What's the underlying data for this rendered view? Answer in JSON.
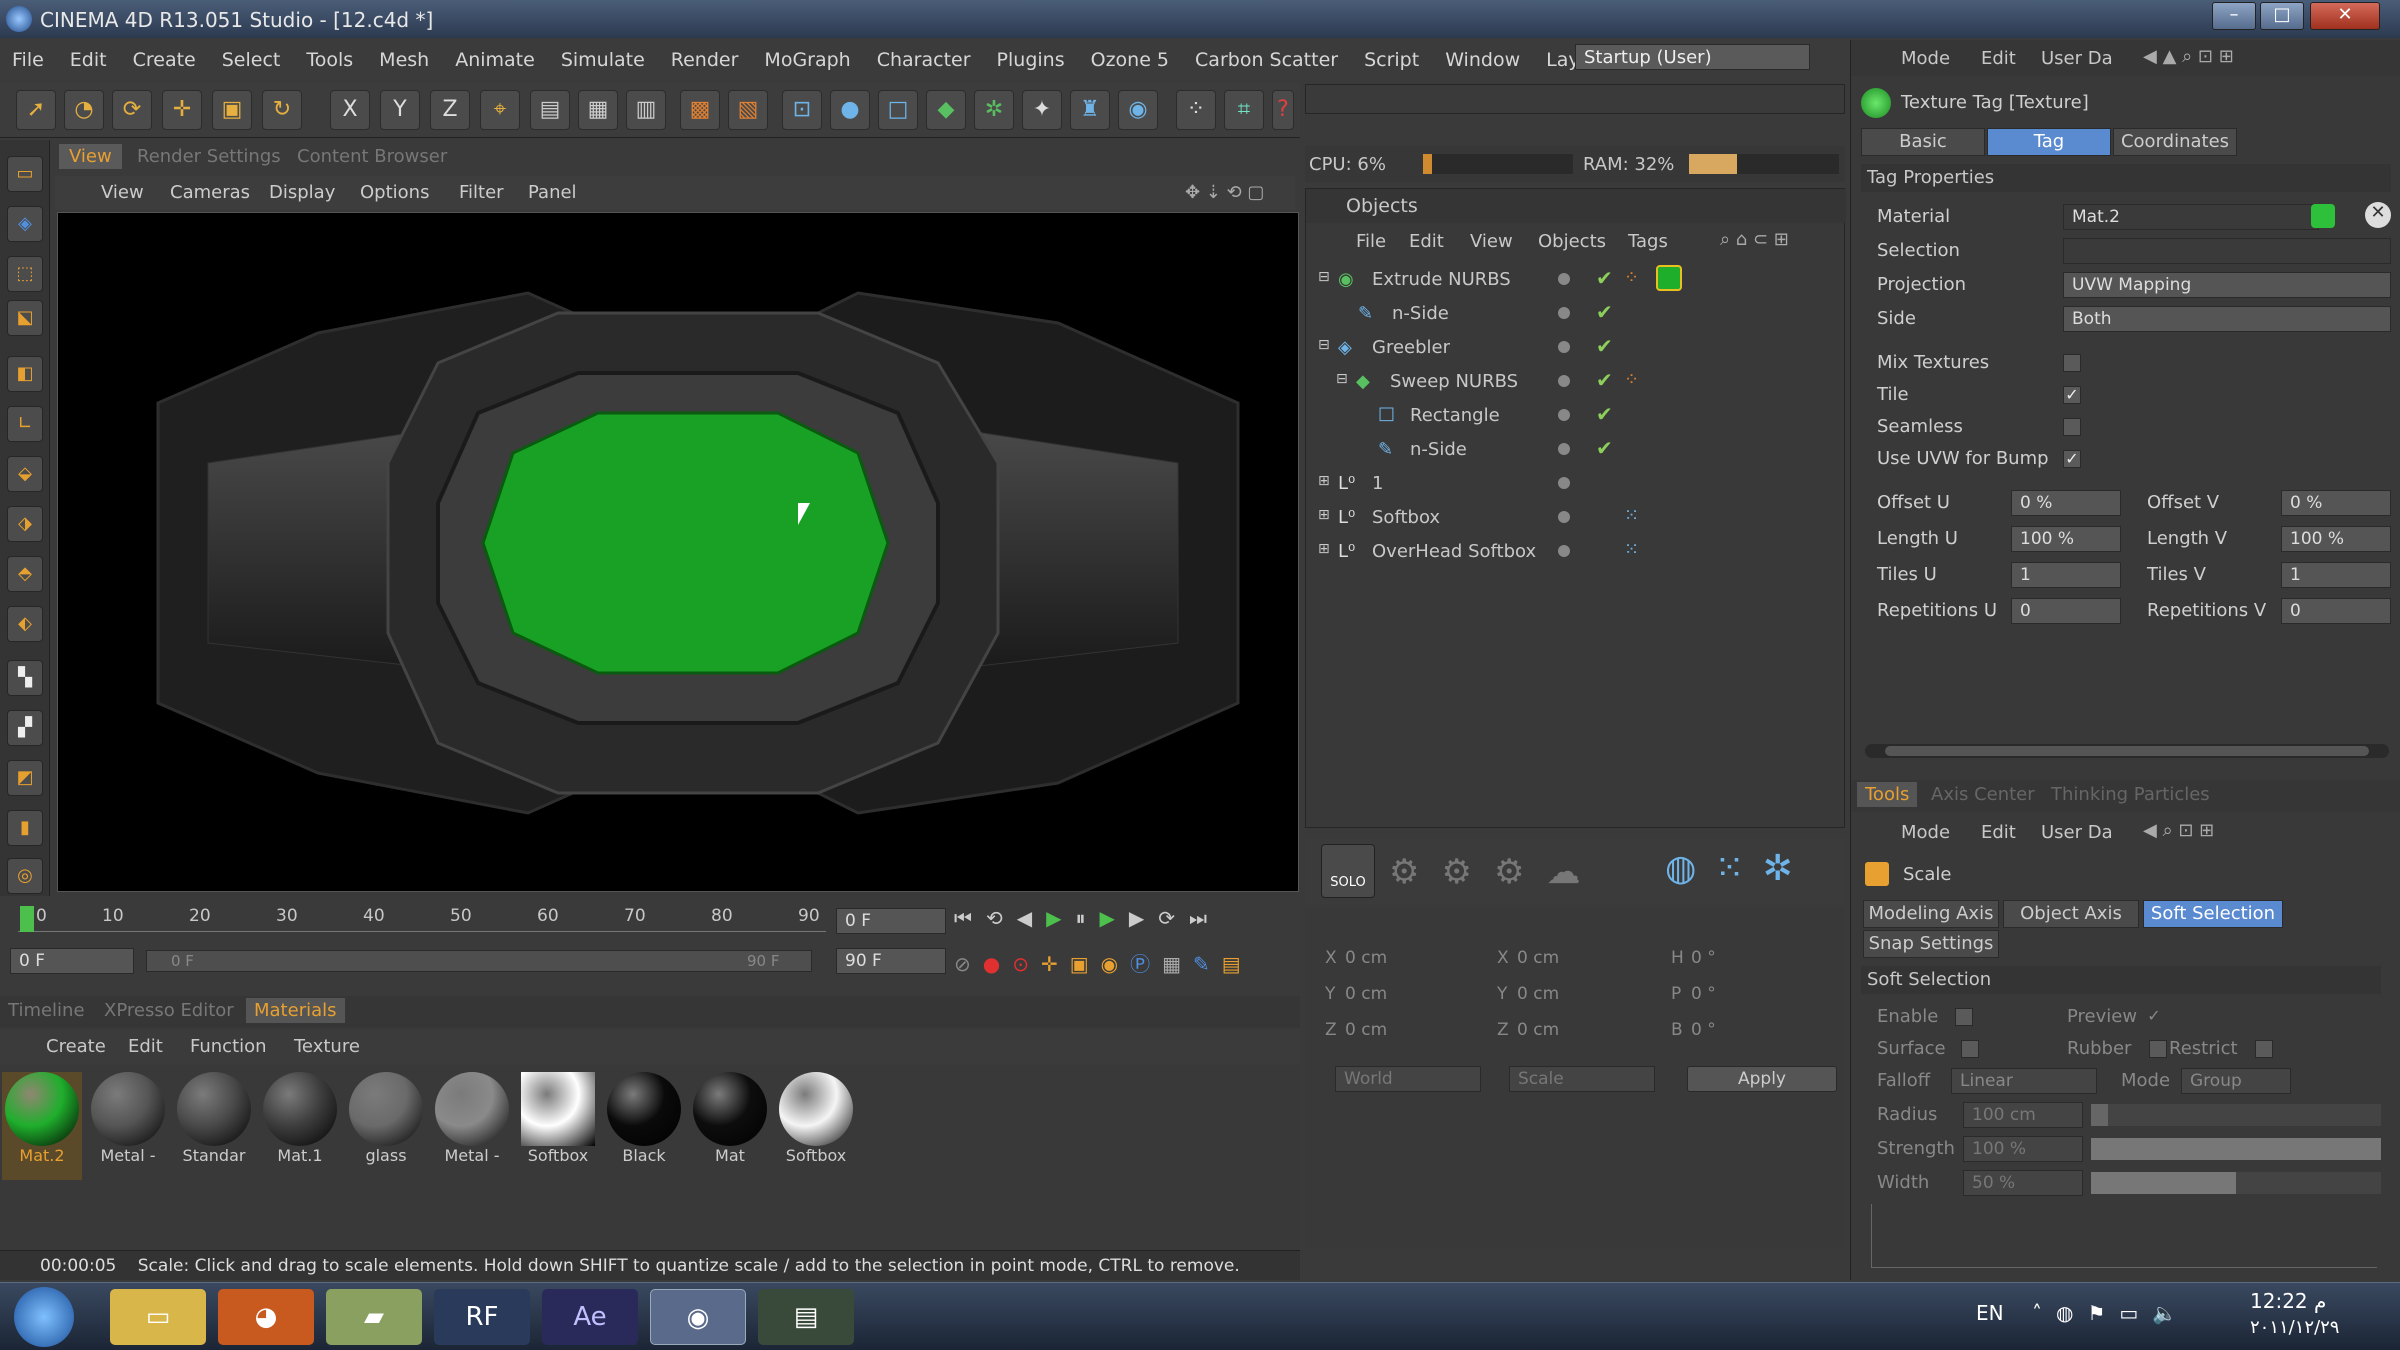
{
  "window": {
    "title": "CINEMA 4D R13.051 Studio - [12.c4d *]",
    "minimize": "–",
    "maximize": "□",
    "close": "✕"
  },
  "menu": {
    "items": [
      "File",
      "Edit",
      "Create",
      "Select",
      "Tools",
      "Mesh",
      "Animate",
      "Simulate",
      "Render",
      "MoGraph",
      "Character",
      "Plugins",
      "Ozone 5",
      "Carbon Scatter",
      "Script",
      "Window"
    ],
    "layout_label": "Layout:",
    "layout_value": "Startup (User)"
  },
  "toolbar": {
    "x": "X",
    "y": "Y",
    "z": "Z"
  },
  "view": {
    "tabs": [
      "View",
      "Render Settings",
      "Content Browser"
    ],
    "menu": [
      "View",
      "Cameras",
      "Display",
      "Options",
      "Filter",
      "Panel"
    ]
  },
  "timeline": {
    "ticks": [
      "0",
      "10",
      "20",
      "30",
      "40",
      "50",
      "60",
      "70",
      "80",
      "90"
    ],
    "current": "0 F",
    "start": "0 F",
    "range_start": "0 F",
    "range_end": "90 F",
    "end": "90 F"
  },
  "materials": {
    "tabs": [
      "Timeline",
      "XPresso Editor",
      "Materials"
    ],
    "menu": [
      "Create",
      "Edit",
      "Function",
      "Texture"
    ],
    "items": [
      {
        "name": "Mat.2",
        "color": "#1fae2c"
      },
      {
        "name": "Metal -",
        "color": "#555555"
      },
      {
        "name": "Standar",
        "color": "#4a4a4a"
      },
      {
        "name": "Mat.1",
        "color": "#3e3e3e"
      },
      {
        "name": "glass",
        "color": "#6a6a6a"
      },
      {
        "name": "Metal -",
        "color": "#8a8a8a"
      },
      {
        "name": "Softbox",
        "color": "#ffffff"
      },
      {
        "name": "Black",
        "color": "#0a0a0a"
      },
      {
        "name": "Mat",
        "color": "#0d0d0d"
      },
      {
        "name": "Softbox",
        "color": "#f5f5f5"
      }
    ]
  },
  "status": {
    "time": "00:00:05",
    "message": "Scale: Click and drag to scale elements. Hold down SHIFT to quantize scale / add to the selection in point mode, CTRL to remove."
  },
  "perf": {
    "cpu": "CPU: 6%",
    "cpu_value": 0.06,
    "ram": "RAM: 32%",
    "ram_value": 0.32
  },
  "objects": {
    "title": "Objects",
    "menu": [
      "File",
      "Edit",
      "View",
      "Objects",
      "Tags"
    ],
    "rows": [
      {
        "name": "Extrude NURBS"
      },
      {
        "name": "n-Side"
      },
      {
        "name": "Greebler"
      },
      {
        "name": "Sweep NURBS"
      },
      {
        "name": "Rectangle"
      },
      {
        "name": "n-Side"
      },
      {
        "name": "1"
      },
      {
        "name": "Softbox"
      },
      {
        "name": "OverHead Softbox"
      }
    ]
  },
  "iconstrip": {
    "solo": "SOLO"
  },
  "coords": {
    "rows": [
      [
        "X",
        "0 cm",
        "X",
        "0 cm",
        "H",
        "0 °"
      ],
      [
        "Y",
        "0 cm",
        "Y",
        "0 cm",
        "P",
        "0 °"
      ],
      [
        "Z",
        "0 cm",
        "Z",
        "0 cm",
        "B",
        "0 °"
      ]
    ],
    "world": "World",
    "scale": "Scale",
    "apply": "Apply"
  },
  "attributes": {
    "menu": [
      "Mode",
      "Edit",
      "User Da"
    ],
    "tag_title": "Texture Tag [Texture]",
    "tabs": [
      "Basic",
      "Tag",
      "Coordinates"
    ],
    "section": "Tag Properties",
    "material_label": "Material",
    "material_value": "Mat.2",
    "selection_label": "Selection",
    "projection_label": "Projection",
    "projection_value": "UVW Mapping",
    "side_label": "Side",
    "side_value": "Both",
    "mix_label": "Mix Textures",
    "tile_label": "Tile",
    "seamless_label": "Seamless",
    "uvw_label": "Use UVW for Bump",
    "check": "✓",
    "offsetu_label": "Offset U",
    "offsetu": "0 %",
    "offsetv_label": "Offset V",
    "offsetv": "0 %",
    "lengthu_label": "Length U",
    "lengthu": "100 %",
    "lengthv_label": "Length V",
    "lengthv": "100 %",
    "tilesu_label": "Tiles U",
    "tilesu": "1",
    "tilesv_label": "Tiles V",
    "tilesv": "1",
    "repu_label": "Repetitions U",
    "repu": "0",
    "repv_label": "Repetitions V",
    "repv": "0"
  },
  "tools": {
    "tabs": [
      "Tools",
      "Axis Center",
      "Thinking Particles"
    ],
    "menu": [
      "Mode",
      "Edit",
      "User Da"
    ],
    "title": "Scale",
    "subtabs": [
      "Modeling Axis",
      "Object Axis",
      "Soft Selection",
      "Snap Settings"
    ],
    "section": "Soft Selection",
    "enable": "Enable",
    "preview": "Preview",
    "surface": "Surface",
    "rubber": "Rubber",
    "restrict": "Restrict",
    "falloff_label": "Falloff",
    "falloff": "Linear",
    "mode_label": "Mode",
    "mode": "Group",
    "radius_label": "Radius",
    "radius": "100 cm",
    "strength_label": "Strength",
    "strength": "100 %",
    "width_label": "Width",
    "width": "50 %"
  },
  "taskbar": {
    "lang": "EN",
    "time": "12:22 م",
    "date": "۲۰۱۱/۱۲/۲۹",
    "apps": [
      "RF",
      "Ae"
    ]
  }
}
